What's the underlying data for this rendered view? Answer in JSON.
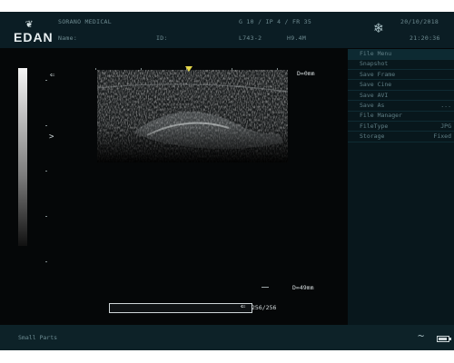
{
  "header": {
    "logo_text": "EDAN",
    "hospital": "SORANO MEDICAL",
    "name_label": "Name:",
    "id_label": "ID:",
    "params": "G 10 / IP 4 / FR 35",
    "probe": "L743-2",
    "frequency": "H9.4M",
    "date": "20/10/2018",
    "time": "21:20:36",
    "freeze_icon": "snowflake-icon"
  },
  "left_markers": {
    "arrow_symbol": "⇐",
    "chevron_symbol": ">"
  },
  "image": {
    "depth_top": "D=0mm",
    "depth_bottom": "D=49mm"
  },
  "cine": {
    "count": "256/256",
    "progress": 1.0,
    "arrow_symbol": "⇐"
  },
  "menu": {
    "items": [
      {
        "label": "File Menu",
        "value": ""
      },
      {
        "label": "Snapshot",
        "value": ""
      },
      {
        "label": "Save Frame",
        "value": ""
      },
      {
        "label": "Save Cine",
        "value": ""
      },
      {
        "label": "Save AVI",
        "value": ""
      },
      {
        "label": "Save As",
        "value": "..."
      },
      {
        "label": "File Manager",
        "value": ""
      },
      {
        "label": "FileType",
        "value": "JPG"
      },
      {
        "label": "Storage",
        "value": "Fixed"
      }
    ]
  },
  "footer": {
    "mode": "Small Parts",
    "wave_symbol": "~",
    "battery_level": 0.85
  },
  "colors": {
    "background": "#050708",
    "header": "#0b1d24",
    "panel": "#08171c",
    "highlight": "#0d2a32",
    "focus_marker": "#e6d84a"
  }
}
